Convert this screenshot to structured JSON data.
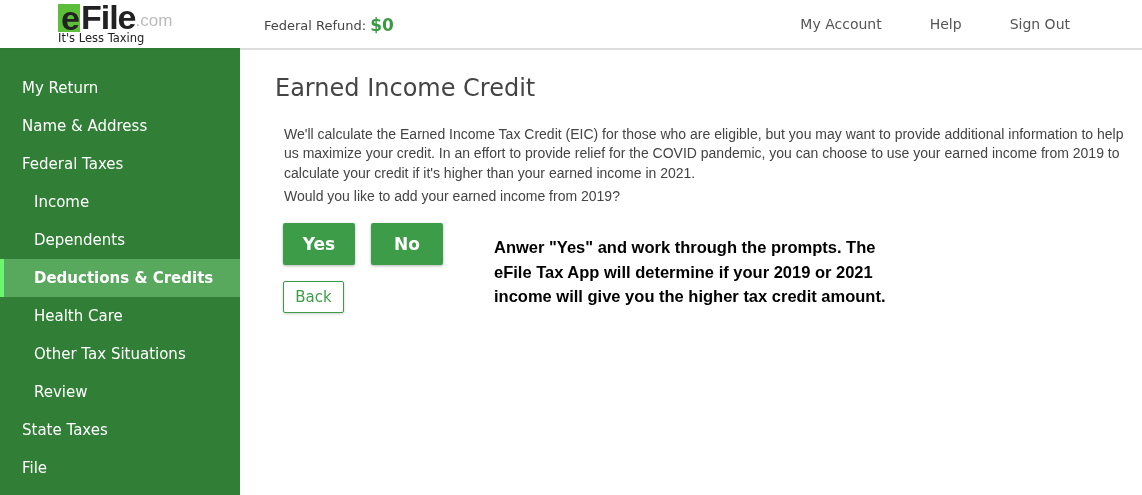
{
  "header": {
    "logo": {
      "brand": "eFile",
      "domain": ".com",
      "tagline": "It's Less Taxing"
    },
    "refund_label": "Federal Refund:",
    "refund_amount": "$0",
    "nav": [
      "My Account",
      "Help",
      "Sign Out"
    ]
  },
  "sidebar": {
    "items": [
      {
        "label": "My Return",
        "selected": false
      },
      {
        "label": "Name & Address",
        "selected": false
      },
      {
        "label": "Federal Taxes",
        "selected": false,
        "children": [
          {
            "label": "Income",
            "selected": false
          },
          {
            "label": "Dependents",
            "selected": false
          },
          {
            "label": "Deductions & Credits",
            "selected": true
          },
          {
            "label": "Health Care",
            "selected": false
          },
          {
            "label": "Other Tax Situations",
            "selected": false
          },
          {
            "label": "Review",
            "selected": false
          }
        ]
      },
      {
        "label": "State Taxes",
        "selected": false
      },
      {
        "label": "File",
        "selected": false
      }
    ]
  },
  "main": {
    "title": "Earned Income Credit",
    "intro": "We'll calculate the Earned Income Tax Credit (EIC) for those who are eligible, but you may want to provide additional information to help us maximize your credit. In an effort to provide relief for the COVID pandemic, you can choose to use your earned income from 2019 to calculate your credit if it's higher than your earned income in 2021.",
    "question": "Would you like to add your earned income from 2019?",
    "buttons": [
      "Yes",
      "No"
    ],
    "back": "Back",
    "annotation": "Anwer \"Yes\" and work through the prompts. The eFile Tax App will determine if your 2019 or 2021 income will give you the higher tax credit amount."
  }
}
